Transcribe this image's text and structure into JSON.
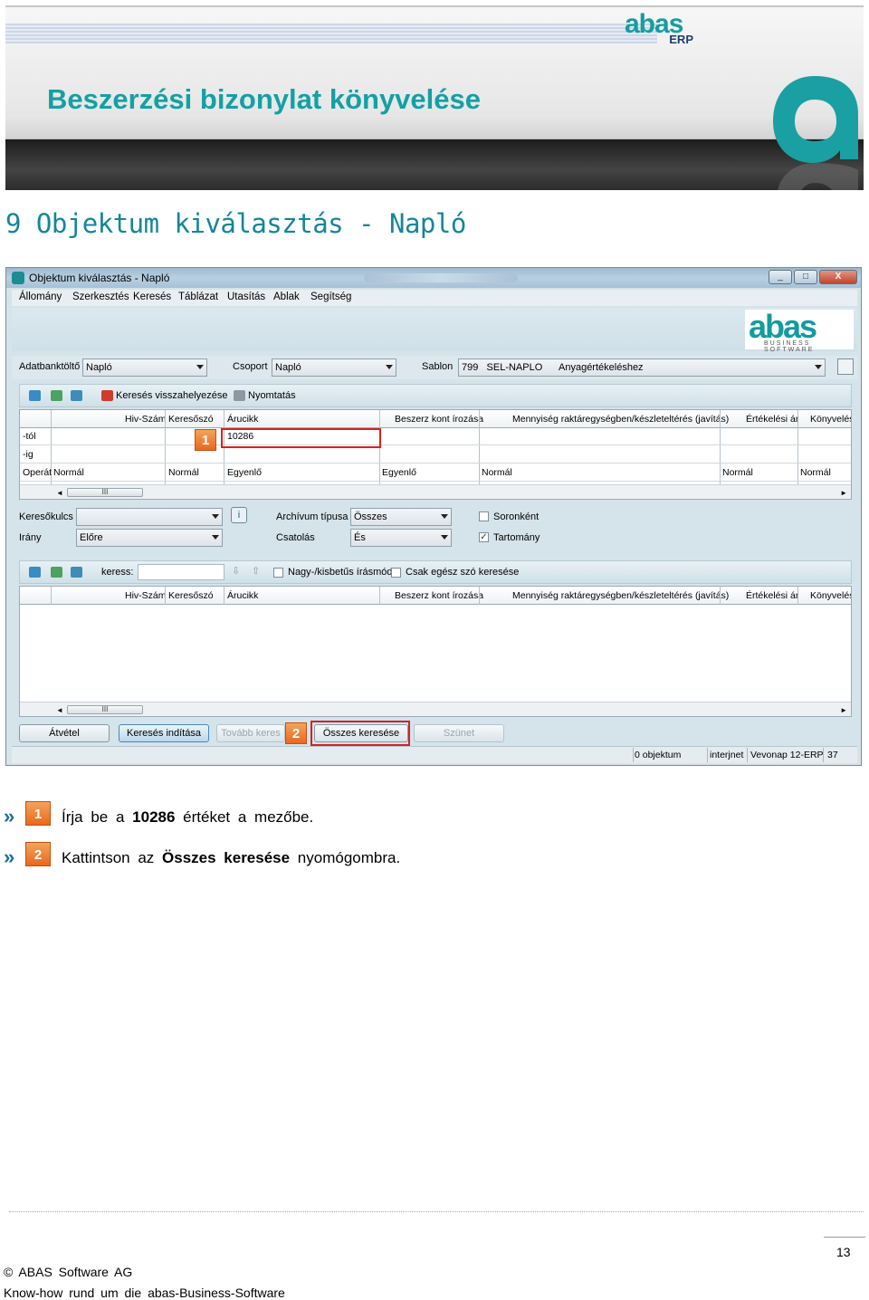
{
  "header": {
    "title": "Beszerzési bizonylat könyvelése",
    "logo_word": "abas",
    "logo_erp": "ERP"
  },
  "section_title": "9 Objektum kiválasztás - Napló",
  "window": {
    "title": "Objektum kiválasztás - Napló",
    "controls": [
      "_",
      "□",
      "X"
    ],
    "menu": [
      "Állomány",
      "Szerkesztés",
      "Keresés",
      "Táblázat",
      "Utasítás",
      "Ablak",
      "Segítség"
    ],
    "logo_word": "abas",
    "logo_sub": "BUSINESS SOFTWARE",
    "fields": {
      "adatbank_label": "Adatbanktöltő",
      "adatbank_value": "Napló",
      "csoport_label": "Csoport",
      "csoport_value": "Napló",
      "sablon_label": "Sablon",
      "sablon_value": "799   SEL-NAPLO      Anyagértékeléshez"
    },
    "toolbar1": {
      "reset_label": "Keresés visszahelyezése",
      "print_label": "Nyomtatás"
    },
    "columns": [
      "Hiv-Szám",
      "Keresőszó",
      "Árucikk",
      "Beszerz kont írozása",
      "Mennyiség raktáregységben/készleteltérés (javítás)",
      "Értékelési ár",
      "Könyvelés"
    ],
    "rows": [
      {
        "label": "-tól",
        "cells": [
          "",
          "",
          "10286",
          "",
          "",
          "",
          ""
        ]
      },
      {
        "label": "-ig",
        "cells": [
          "",
          "",
          "",
          "",
          "",
          "",
          ""
        ]
      },
      {
        "label": "Operát",
        "cells": [
          "Normál",
          "Normál",
          "Egyenlő",
          "Egyenlő",
          "Normál",
          "Normál",
          "Normál"
        ]
      }
    ],
    "scroll_thumb": "III",
    "options": {
      "keresokulcs_label": "Keresőkulcs",
      "keresokulcs_value": "",
      "irany_label": "Irány",
      "irany_value": "Előre",
      "archivum_label": "Archívum típusa",
      "archivum_value": "Összes",
      "csatolas_label": "Csatolás",
      "csatolas_value": "És",
      "soronkent_label": "Soronként",
      "soronkent_checked": false,
      "tartomany_label": "Tartomány",
      "tartomany_checked": true
    },
    "toolbar2": {
      "search_label": "keress:",
      "search_value": "",
      "case_label": "Nagy-/kisbetűs írásmód",
      "whole_word_label": "Csak egész szó keresése"
    },
    "buttons": {
      "atvetel": "Átvétel",
      "kereses_inditasa": "Keresés indítása",
      "tovabb": "Tovább keres",
      "osszes": "Összes keresése",
      "szunet": "Szünet"
    },
    "status": {
      "objects": "0 objektum",
      "interjnet": "interjnet",
      "vevonap": "Vevonap 12-ERP",
      "num": "37"
    }
  },
  "callouts": [
    "1",
    "2"
  ],
  "instructions": [
    {
      "badge": "1",
      "pre": "Írja  be  a ",
      "bold": "10286",
      "post": " értéket  a  mezőbe."
    },
    {
      "badge": "2",
      "pre": "Kattintson  az ",
      "bold": "Összes keresése",
      "post": " nyomógombra."
    }
  ],
  "footer": {
    "page": "13",
    "copyright": "© ABAS Software AG",
    "tagline": "Know-how rund um die abas-Business-Software"
  },
  "colors": {
    "teal": "#14a0a4",
    "callout_red": "#d32222",
    "badge_orange": "#e7691f"
  }
}
